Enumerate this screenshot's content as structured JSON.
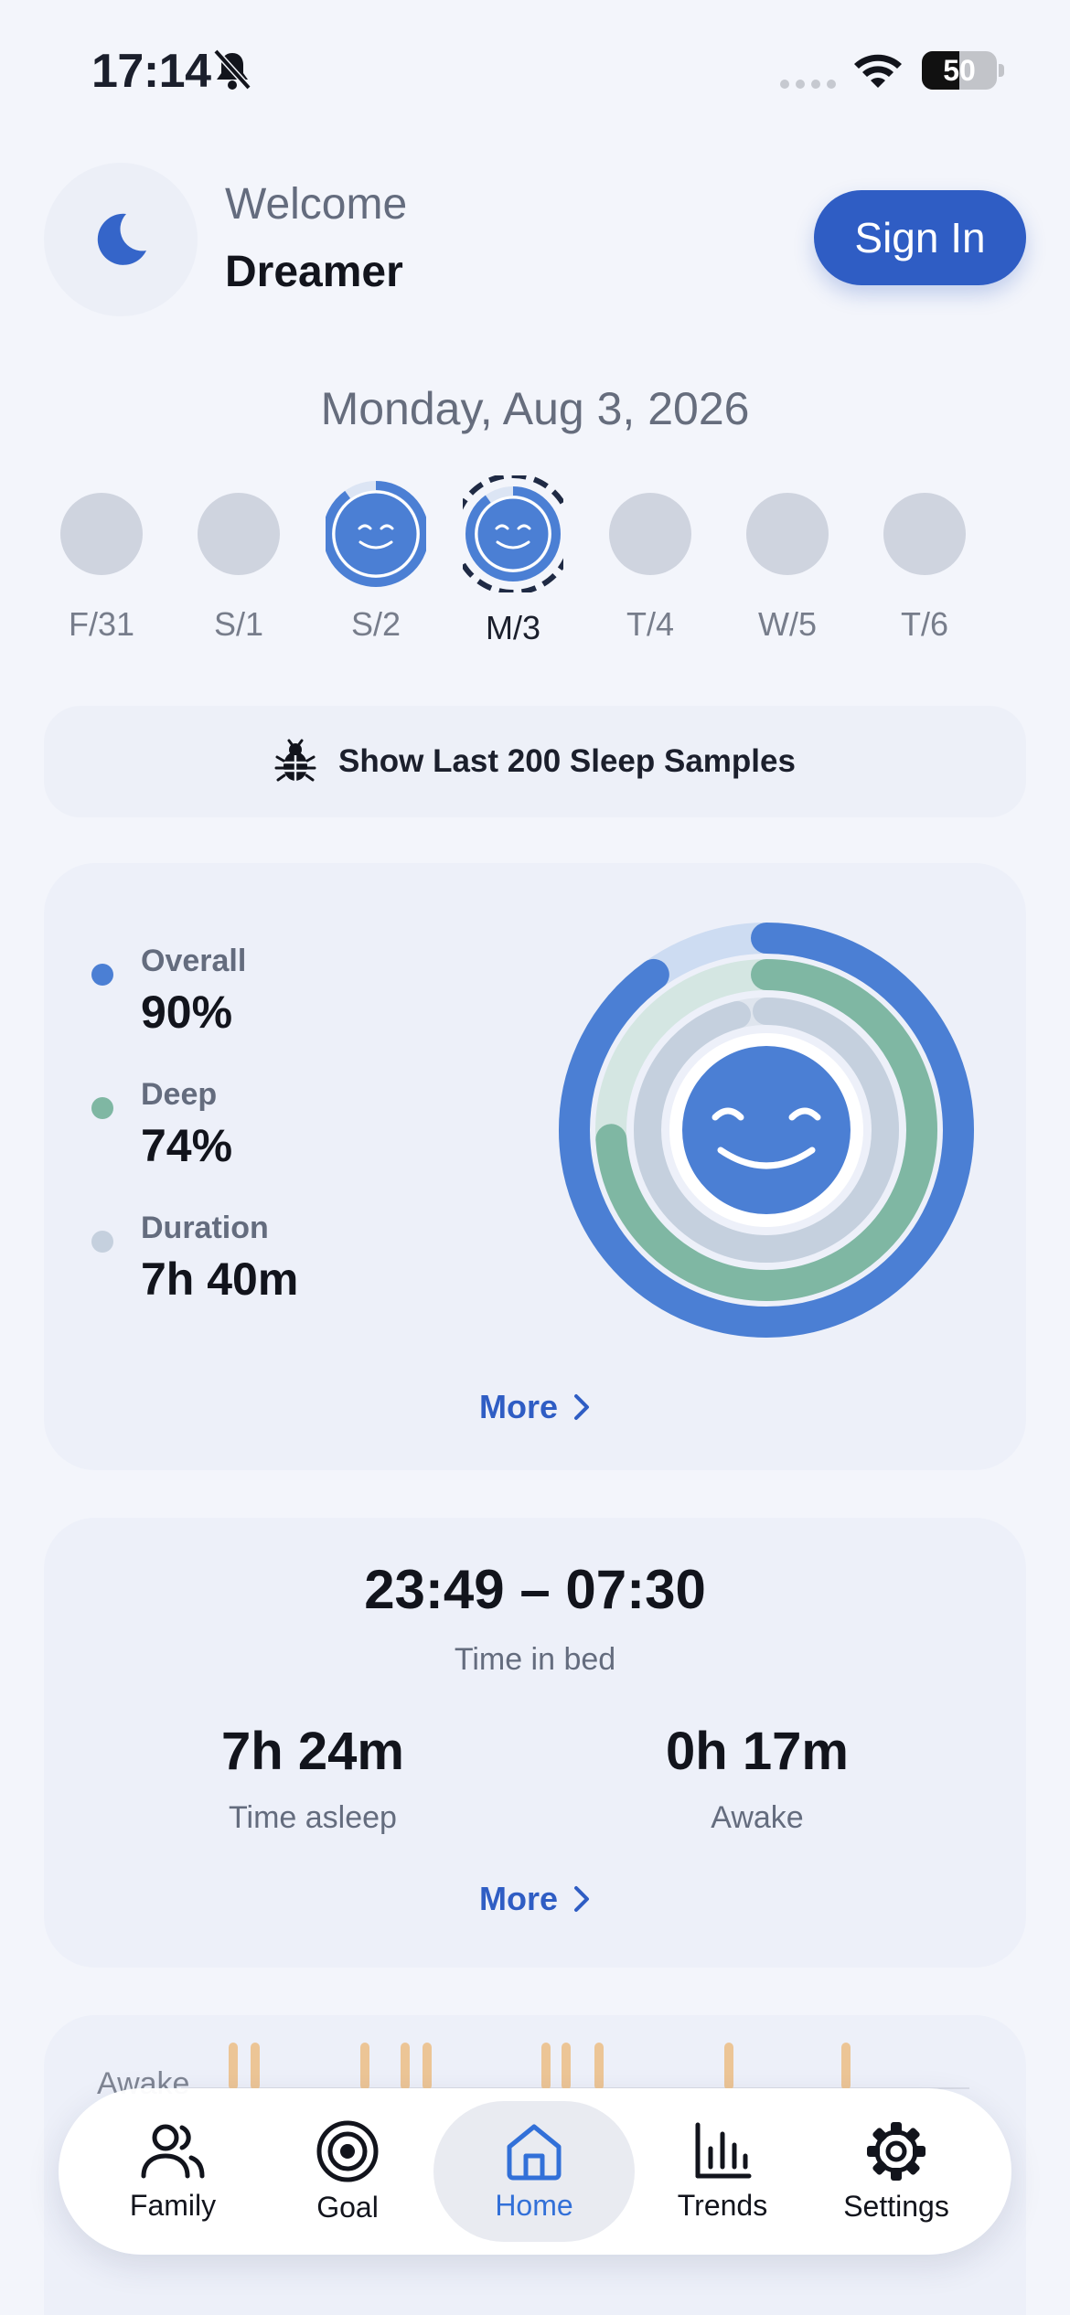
{
  "status_bar": {
    "time": "17:14",
    "battery_level": "50",
    "battery_fraction": 0.5
  },
  "header": {
    "welcome": "Welcome",
    "username": "Dreamer",
    "sign_in_label": "Sign In"
  },
  "date": "Monday, Aug 3, 2026",
  "week": [
    {
      "label": "F/31",
      "state": "empty"
    },
    {
      "label": "S/1",
      "state": "empty"
    },
    {
      "label": "S/2",
      "state": "scored",
      "score": 0.9
    },
    {
      "label": "M/3",
      "state": "selected",
      "score": 0.9
    },
    {
      "label": "T/4",
      "state": "empty"
    },
    {
      "label": "W/5",
      "state": "empty"
    },
    {
      "label": "T/6",
      "state": "empty"
    }
  ],
  "debug_button": {
    "label": "Show Last 200 Sleep Samples"
  },
  "score_card": {
    "metrics": [
      {
        "label": "Overall",
        "value": "90%",
        "color": "#4b7fd4",
        "fraction": 0.9
      },
      {
        "label": "Deep",
        "value": "74%",
        "color": "#7fb7a3",
        "fraction": 0.74
      },
      {
        "label": "Duration",
        "value": "7h 40m",
        "color": "#c5d0de",
        "fraction": 0.96
      }
    ],
    "more_label": "More"
  },
  "bed_card": {
    "time_range": "23:49 – 07:30",
    "time_range_label": "Time in bed",
    "asleep_value": "7h 24m",
    "asleep_label": "Time asleep",
    "awake_value": "0h 17m",
    "awake_label": "Awake",
    "more_label": "More"
  },
  "hypnogram_card": {
    "awake_label": "Awake"
  },
  "nav": {
    "tabs": [
      {
        "label": "Family",
        "icon": "people-icon"
      },
      {
        "label": "Goal",
        "icon": "target-icon"
      },
      {
        "label": "Home",
        "icon": "home-icon",
        "active": true
      },
      {
        "label": "Trends",
        "icon": "bar-chart-icon"
      },
      {
        "label": "Settings",
        "icon": "gear-icon"
      }
    ]
  },
  "colors": {
    "accent": "#2f5dc4",
    "overall": "#4b7fd4",
    "deep": "#7fb7a3",
    "duration": "#c5d0de",
    "active_tab": "#3270d8"
  }
}
